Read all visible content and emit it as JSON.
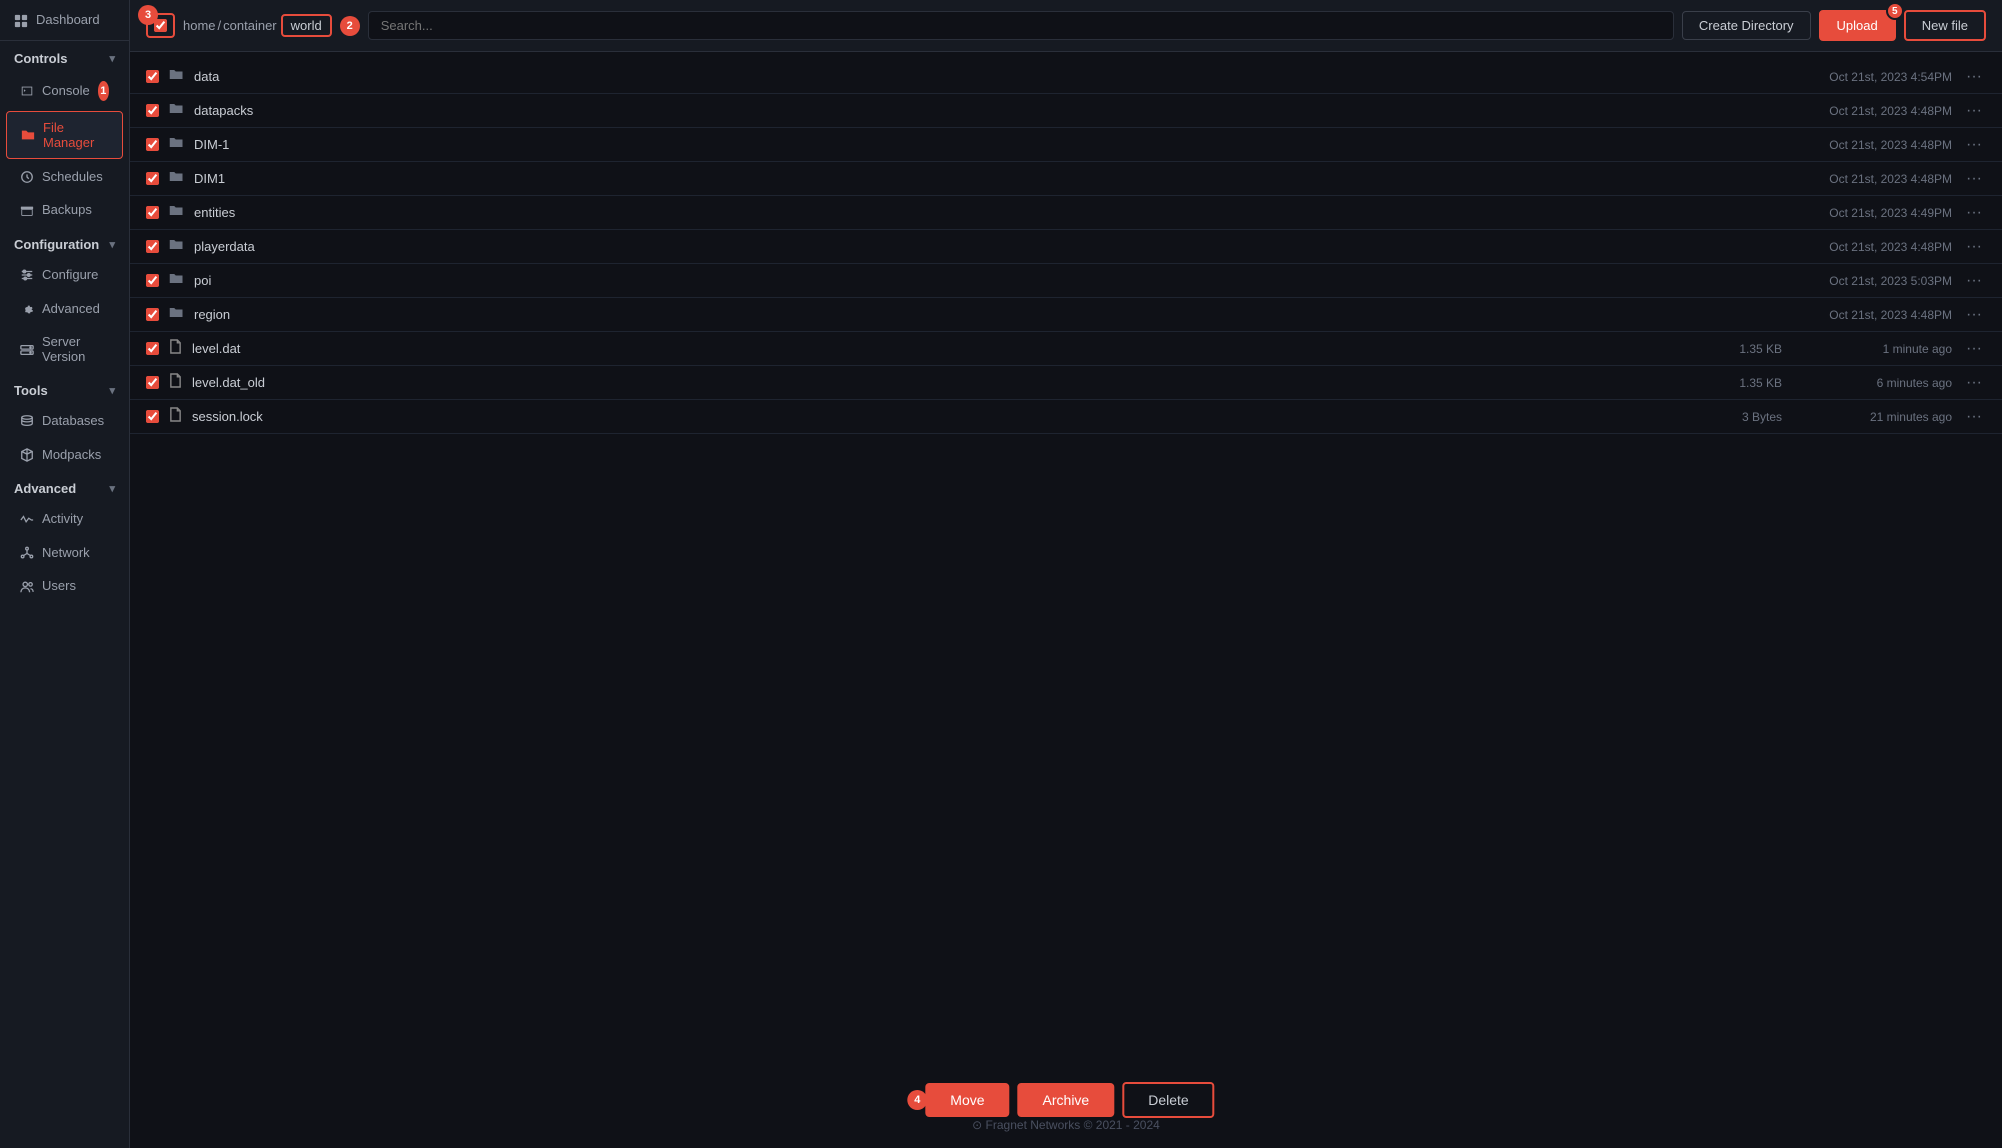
{
  "sidebar": {
    "dashboard_label": "Dashboard",
    "sections": [
      {
        "name": "Controls",
        "items": [
          {
            "id": "console",
            "label": "Console",
            "icon": "terminal"
          },
          {
            "id": "file-manager",
            "label": "File Manager",
            "icon": "folder",
            "active": true
          },
          {
            "id": "schedules",
            "label": "Schedules",
            "icon": "clock"
          },
          {
            "id": "backups",
            "label": "Backups",
            "icon": "archive"
          }
        ]
      },
      {
        "name": "Configuration",
        "items": [
          {
            "id": "configure",
            "label": "Configure",
            "icon": "sliders"
          },
          {
            "id": "advanced",
            "label": "Advanced",
            "icon": "settings"
          },
          {
            "id": "server-version",
            "label": "Server Version",
            "icon": "server"
          }
        ]
      },
      {
        "name": "Tools",
        "items": [
          {
            "id": "databases",
            "label": "Databases",
            "icon": "database"
          },
          {
            "id": "modpacks",
            "label": "Modpacks",
            "icon": "package"
          }
        ]
      },
      {
        "name": "Advanced",
        "items": [
          {
            "id": "activity",
            "label": "Activity",
            "icon": "activity"
          },
          {
            "id": "network",
            "label": "Network",
            "icon": "network"
          },
          {
            "id": "users",
            "label": "Users",
            "icon": "users"
          }
        ]
      }
    ]
  },
  "topbar": {
    "breadcrumb": {
      "parts": [
        "home",
        "/",
        "container"
      ],
      "current": "world",
      "separator": "/"
    },
    "search_placeholder": "Search...",
    "create_dir_label": "Create Directory",
    "upload_label": "Upload",
    "new_file_label": "New file",
    "badge_3": "3",
    "badge_2": "2",
    "badge_5": "5"
  },
  "files": [
    {
      "name": "data",
      "type": "folder",
      "size": "",
      "date": "Oct 21st, 2023 4:54PM"
    },
    {
      "name": "datapacks",
      "type": "folder",
      "size": "",
      "date": "Oct 21st, 2023 4:48PM"
    },
    {
      "name": "DIM-1",
      "type": "folder",
      "size": "",
      "date": "Oct 21st, 2023 4:48PM"
    },
    {
      "name": "DIM1",
      "type": "folder",
      "size": "",
      "date": "Oct 21st, 2023 4:48PM"
    },
    {
      "name": "entities",
      "type": "folder",
      "size": "",
      "date": "Oct 21st, 2023 4:49PM"
    },
    {
      "name": "playerdata",
      "type": "folder",
      "size": "",
      "date": "Oct 21st, 2023 4:48PM"
    },
    {
      "name": "poi",
      "type": "folder",
      "size": "",
      "date": "Oct 21st, 2023 5:03PM"
    },
    {
      "name": "region",
      "type": "folder",
      "size": "",
      "date": "Oct 21st, 2023 4:48PM"
    },
    {
      "name": "level.dat",
      "type": "file",
      "size": "1.35 KB",
      "date": "1 minute ago"
    },
    {
      "name": "level.dat_old",
      "type": "file",
      "size": "1.35 KB",
      "date": "6 minutes ago"
    },
    {
      "name": "session.lock",
      "type": "file",
      "size": "3 Bytes",
      "date": "21 minutes ago"
    }
  ],
  "footer": {
    "text": "⊙ Fragnet Networks © 2021 - 2024"
  },
  "bottom_actions": {
    "move_label": "Move",
    "archive_label": "Archive",
    "delete_label": "Delete",
    "badge": "4"
  }
}
